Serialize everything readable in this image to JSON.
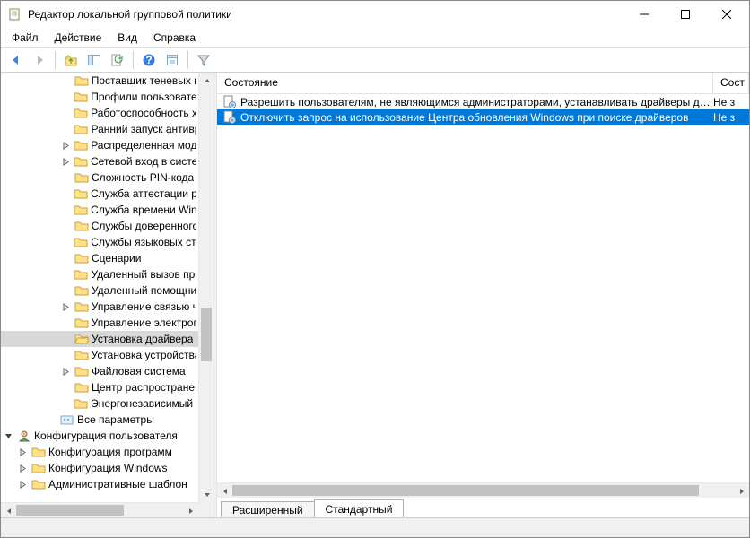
{
  "window": {
    "title": "Редактор локальной групповой политики"
  },
  "menu": {
    "file": "Файл",
    "action": "Действие",
    "view": "Вид",
    "help": "Справка"
  },
  "tree": {
    "items": [
      {
        "depth": 4,
        "exp": "",
        "icon": "folder",
        "label": "Поставщик теневых к"
      },
      {
        "depth": 4,
        "exp": "",
        "icon": "folder",
        "label": "Профили пользовател"
      },
      {
        "depth": 4,
        "exp": "",
        "icon": "folder",
        "label": "Работоспособность хр"
      },
      {
        "depth": 4,
        "exp": "",
        "icon": "folder",
        "label": "Ранний запуск антивр"
      },
      {
        "depth": 4,
        "exp": ">",
        "icon": "folder",
        "label": "Распределенная моде"
      },
      {
        "depth": 4,
        "exp": ">",
        "icon": "folder",
        "label": "Сетевой вход в систем"
      },
      {
        "depth": 4,
        "exp": "",
        "icon": "folder",
        "label": "Сложность PIN-кода"
      },
      {
        "depth": 4,
        "exp": "",
        "icon": "folder",
        "label": "Служба аттестации ра"
      },
      {
        "depth": 4,
        "exp": "",
        "icon": "folder",
        "label": "Служба времени Wind"
      },
      {
        "depth": 4,
        "exp": "",
        "icon": "folder",
        "label": "Службы доверенного"
      },
      {
        "depth": 4,
        "exp": "",
        "icon": "folder",
        "label": "Службы языковых ста"
      },
      {
        "depth": 4,
        "exp": "",
        "icon": "folder",
        "label": "Сценарии"
      },
      {
        "depth": 4,
        "exp": "",
        "icon": "folder",
        "label": "Удаленный вызов про"
      },
      {
        "depth": 4,
        "exp": "",
        "icon": "folder",
        "label": "Удаленный помощни"
      },
      {
        "depth": 4,
        "exp": ">",
        "icon": "folder",
        "label": "Управление связью ч"
      },
      {
        "depth": 4,
        "exp": "",
        "icon": "folder",
        "label": "Управление электроп"
      },
      {
        "depth": 4,
        "exp": "",
        "icon": "folder-open",
        "label": "Установка драйвера",
        "selected": true
      },
      {
        "depth": 4,
        "exp": "",
        "icon": "folder",
        "label": "Установка устройства"
      },
      {
        "depth": 4,
        "exp": ">",
        "icon": "folder",
        "label": "Файловая система"
      },
      {
        "depth": 4,
        "exp": "",
        "icon": "folder",
        "label": "Центр распростране"
      },
      {
        "depth": 4,
        "exp": "",
        "icon": "folder",
        "label": "Энергонезависимый м"
      },
      {
        "depth": 3,
        "exp": "",
        "icon": "all",
        "label": "Все параметры"
      },
      {
        "depth": 0,
        "exp": "v",
        "icon": "user",
        "label": "Конфигурация пользователя"
      },
      {
        "depth": 1,
        "exp": ">",
        "icon": "folder",
        "label": "Конфигурация программ"
      },
      {
        "depth": 1,
        "exp": ">",
        "icon": "folder",
        "label": "Конфигурация Windows"
      },
      {
        "depth": 1,
        "exp": ">",
        "icon": "folder",
        "label": "Административные шаблон"
      }
    ]
  },
  "list": {
    "columns": {
      "state": "Состояние",
      "s2": "Сост"
    },
    "rows": [
      {
        "text": "Разрешить пользователям, не являющимся администраторами, устанавливать драйверы д…",
        "s2": "Не з",
        "selected": false
      },
      {
        "text": "Отключить запрос на использование Центра обновления Windows при поиске драйверов",
        "s2": "Не з",
        "selected": true
      }
    ]
  },
  "tabs": {
    "extended": "Расширенный",
    "standard": "Стандартный"
  }
}
